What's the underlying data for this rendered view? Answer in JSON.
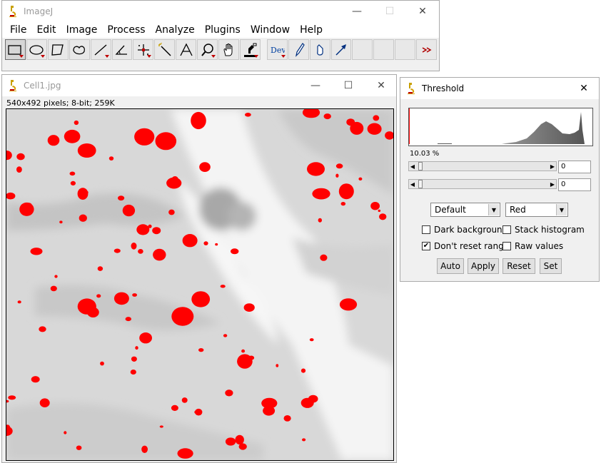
{
  "imagej": {
    "title": "ImageJ",
    "menu": [
      "File",
      "Edit",
      "Image",
      "Process",
      "Analyze",
      "Plugins",
      "Window",
      "Help"
    ],
    "tools": [
      "rectangle-tool",
      "oval-tool",
      "polygon-tool",
      "freehand-tool",
      "line-tool",
      "angle-tool",
      "point-tool",
      "wand-tool",
      "text-tool",
      "magnifier-tool",
      "hand-tool",
      "dropper-tool",
      "developer-menu",
      "brush-tool",
      "flood-fill-tool",
      "arrow-tool",
      "empty-slot",
      "empty-slot",
      "empty-slot",
      "more-tools"
    ],
    "dev_label": "Dev"
  },
  "image_window": {
    "title": "Cell1.jpg",
    "info": "540x492 pixels; 8-bit; 259K"
  },
  "threshold": {
    "title": "Threshold",
    "percent": "10.03 %",
    "slider1_value": "0",
    "slider2_value": "0",
    "method": "Default",
    "display": "Red",
    "dark_background": "Dark background",
    "stack_histogram": "Stack histogram",
    "dont_reset_range": "Don't reset range",
    "raw_values": "Raw values",
    "buttons": [
      "Auto",
      "Apply",
      "Reset",
      "Set"
    ]
  },
  "colors": {
    "threshold_red": "#ff0000",
    "selected_tool": "#d6d6d6"
  }
}
